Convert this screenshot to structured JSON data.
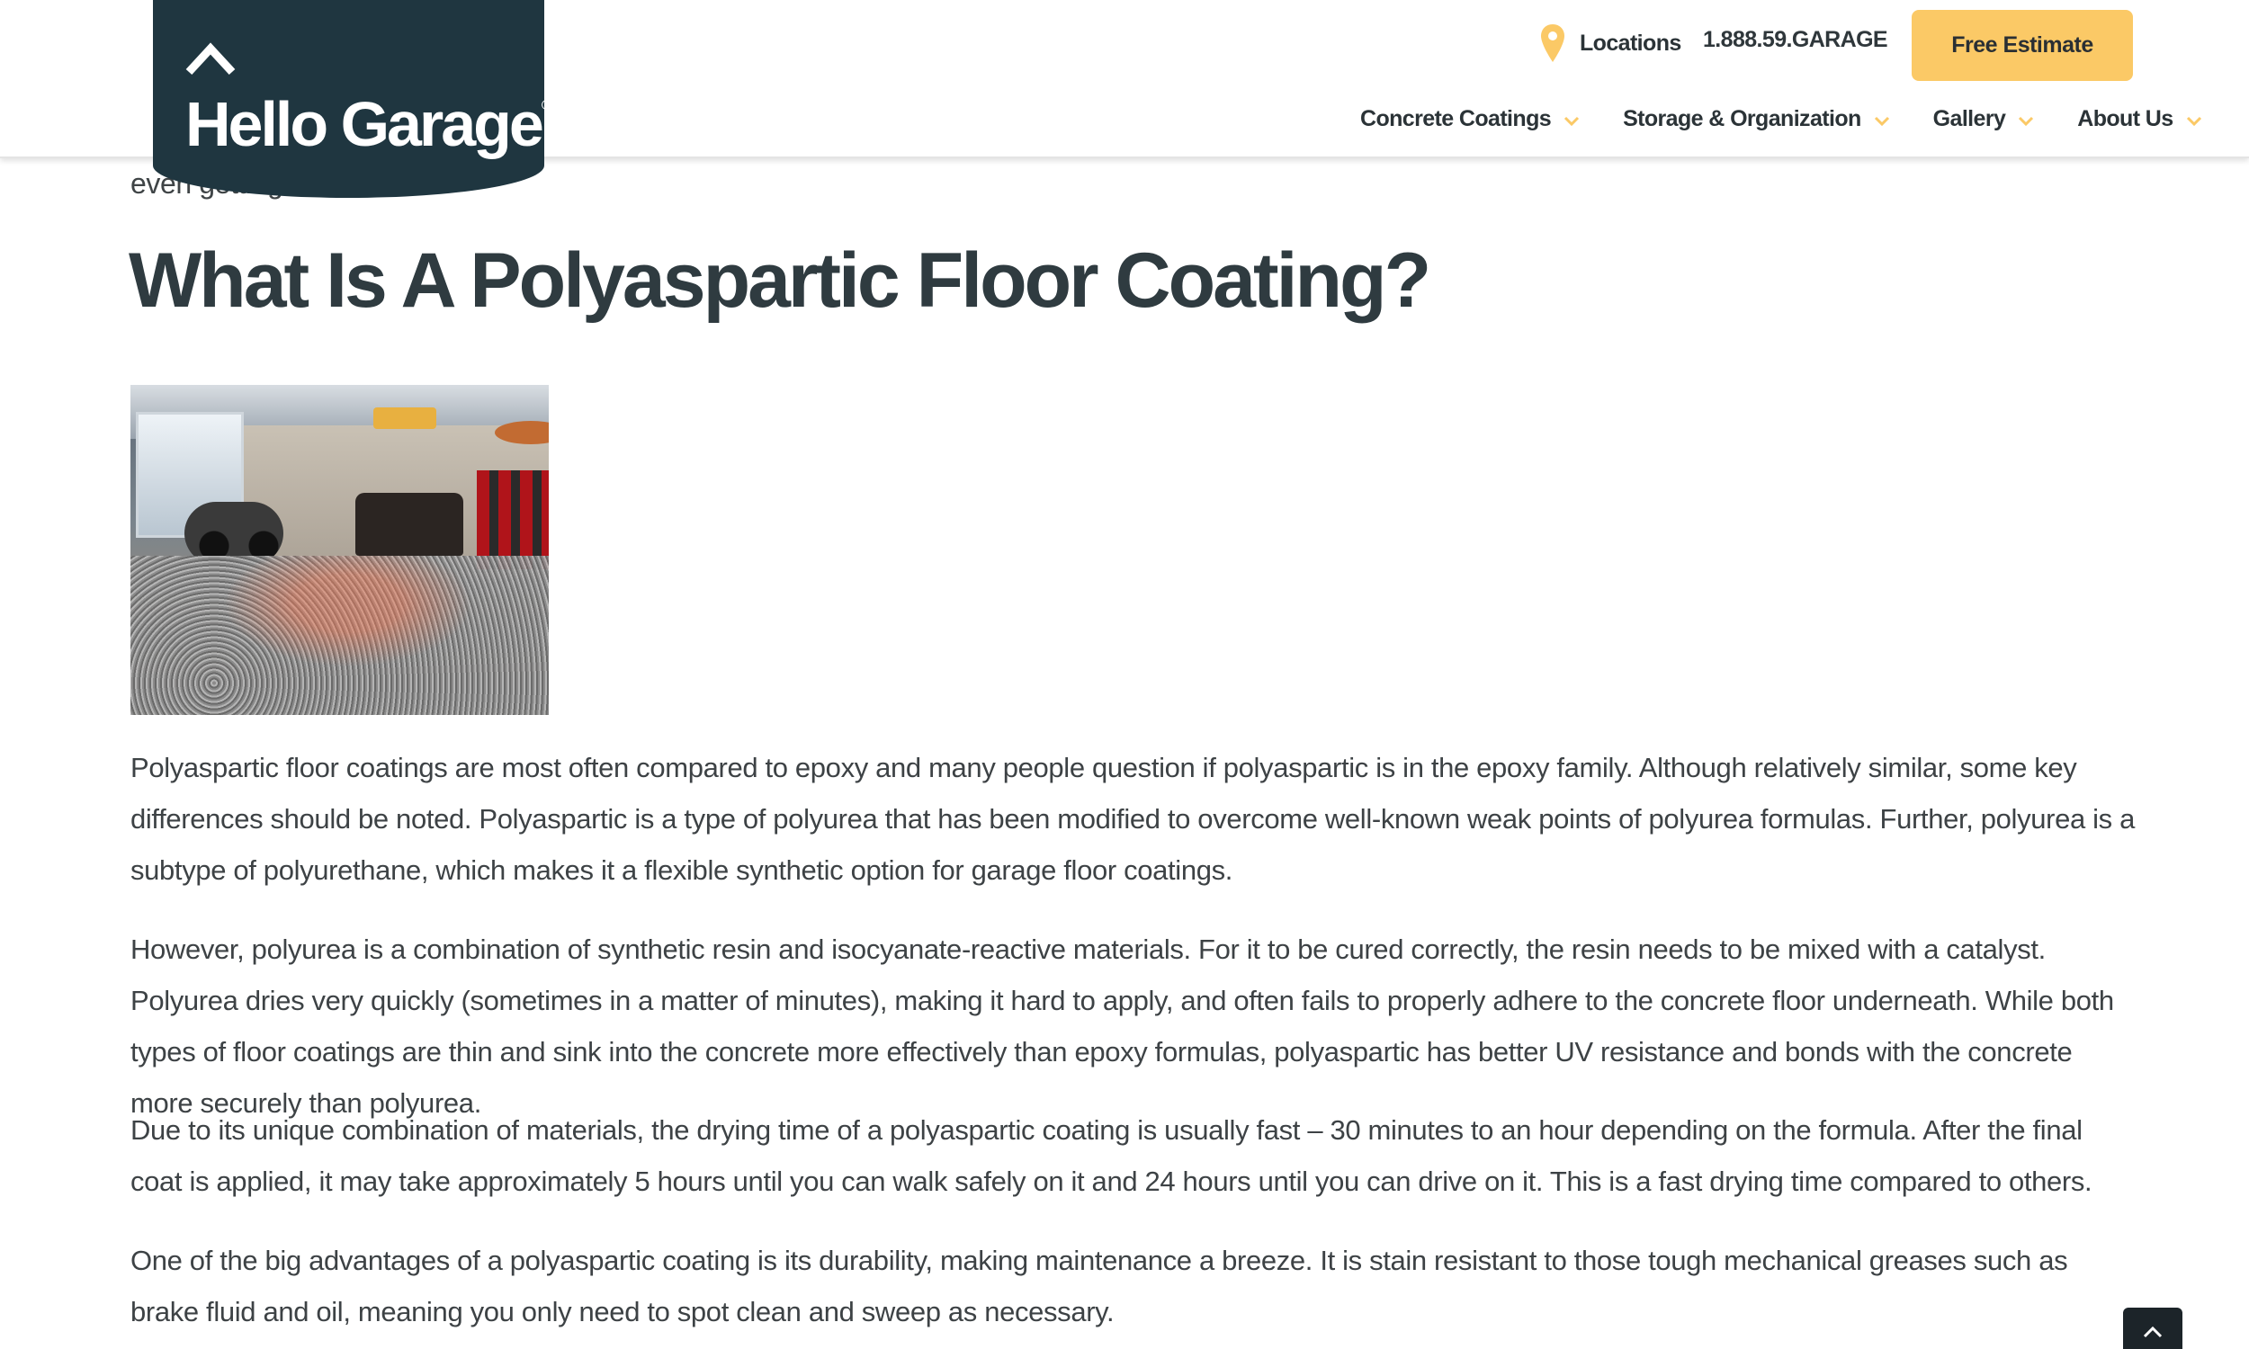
{
  "header": {
    "logo_text": "Hello Garage",
    "logo_mark": "®",
    "locations_label": "Locations",
    "phone": "1.888.59.GARAGE",
    "cta_label": "Free Estimate",
    "accent_color": "#fbc966",
    "logo_bg_color": "#1f3640",
    "icons": {
      "location": "map-pin-icon",
      "logo": "house-roof-icon",
      "dropdown": "chevron-down-icon"
    }
  },
  "nav": {
    "items": [
      {
        "label": "Concrete Coatings"
      },
      {
        "label": "Storage & Organization"
      },
      {
        "label": "Gallery"
      },
      {
        "label": "About Us"
      }
    ]
  },
  "article": {
    "cut_off_text": "even getting starte...",
    "title": "What Is A Polyaspartic Floor Coating?",
    "paragraphs": [
      "Polyaspartic floor coatings are most often compared to epoxy and many people question if polyaspartic is in the epoxy family. Although relatively similar, some key differences should be noted. Polyaspartic is a type of polyurea that has been modified to overcome well-known weak points of polyurea formulas. Further, polyurea is a subtype of polyurethane, which makes it a flexible synthetic option for garage floor coatings.",
      "However, polyurea is a combination of synthetic resin and isocyanate-reactive materials. For it to be cured correctly, the resin needs to be mixed with a catalyst. Polyurea dries very quickly (sometimes in a matter of minutes), making it hard to apply, and often fails to properly adhere to the concrete floor underneath. While both types of floor coatings are thin and sink into the concrete more effectively than epoxy formulas, polyaspartic has better UV resistance and bonds with the concrete more securely than polyurea.",
      "Due to its unique combination of materials, the drying time of a polyaspartic coating is usually fast – 30 minutes to an hour depending on the formula. After the final coat is applied, it may take approximately 5 hours until you can walk safely on it and 24 hours until you can drive on it. This is a fast drying time compared to others.",
      "One of the big advantages of a polyaspartic coating is its durability, making maintenance a breeze. It is stain resistant to those tough mechanical greases such as brake fluid and oil, meaning you only need to spot clean and sweep as necessary."
    ]
  },
  "scroll_top": {
    "icon": "chevron-up-icon"
  }
}
